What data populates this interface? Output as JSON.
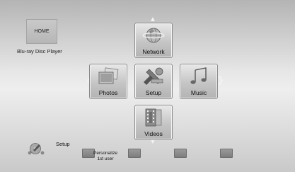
{
  "header": {
    "home_label": "HOME",
    "device_name": "Blu-ray Disc Player"
  },
  "menu": {
    "network": {
      "label": "Network",
      "icon": "globe-icon"
    },
    "photos": {
      "label": "Photos",
      "icon": "photos-icon"
    },
    "setup": {
      "label": "Setup",
      "icon": "tools-icon"
    },
    "music": {
      "label": "Music",
      "icon": "music-note-icon"
    },
    "videos": {
      "label": "Videos",
      "icon": "film-icon"
    }
  },
  "footer": {
    "setup_status": "Setup",
    "color_keys": [
      {
        "label": "Personalize\n1st user"
      },
      {
        "label": ""
      },
      {
        "label": ""
      },
      {
        "label": ""
      }
    ]
  }
}
